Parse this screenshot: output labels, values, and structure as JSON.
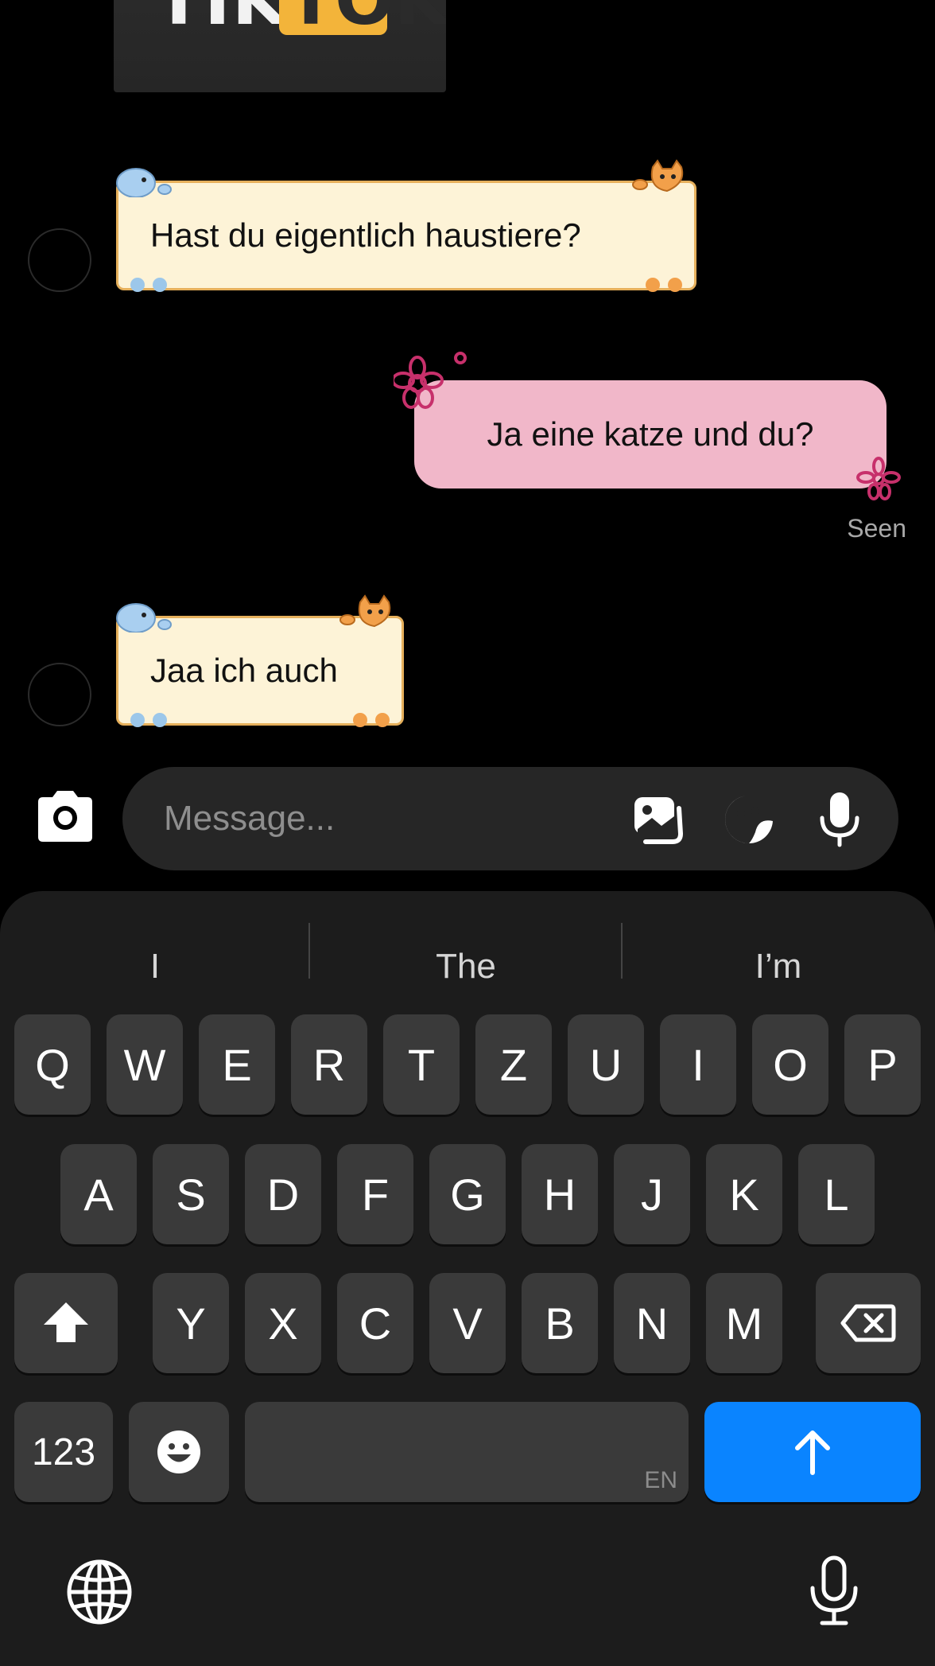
{
  "chat": {
    "messages": [
      {
        "from": "them",
        "text": "Hast du eigentlich haustiere?"
      },
      {
        "from": "me",
        "text": "Ja eine katze und du?"
      },
      {
        "from": "them",
        "text": "Jaa ich auch"
      }
    ],
    "seen_label": "Seen"
  },
  "top_image": {
    "left_text": "TIK",
    "right_text": "TOK"
  },
  "composer": {
    "placeholder": "Message..."
  },
  "keyboard": {
    "suggestions": [
      "I",
      "The",
      "I’m"
    ],
    "row1": [
      "Q",
      "W",
      "E",
      "R",
      "T",
      "Z",
      "U",
      "I",
      "O",
      "P"
    ],
    "row2": [
      "A",
      "S",
      "D",
      "F",
      "G",
      "H",
      "J",
      "K",
      "L"
    ],
    "row3": [
      "Y",
      "X",
      "C",
      "V",
      "B",
      "N",
      "M"
    ],
    "numbers_label": "123",
    "space_lang": "EN"
  },
  "colors": {
    "send": "#0a84ff",
    "sent_bubble": "#f1b7c9",
    "received_bubble": "#fdf3d7"
  }
}
